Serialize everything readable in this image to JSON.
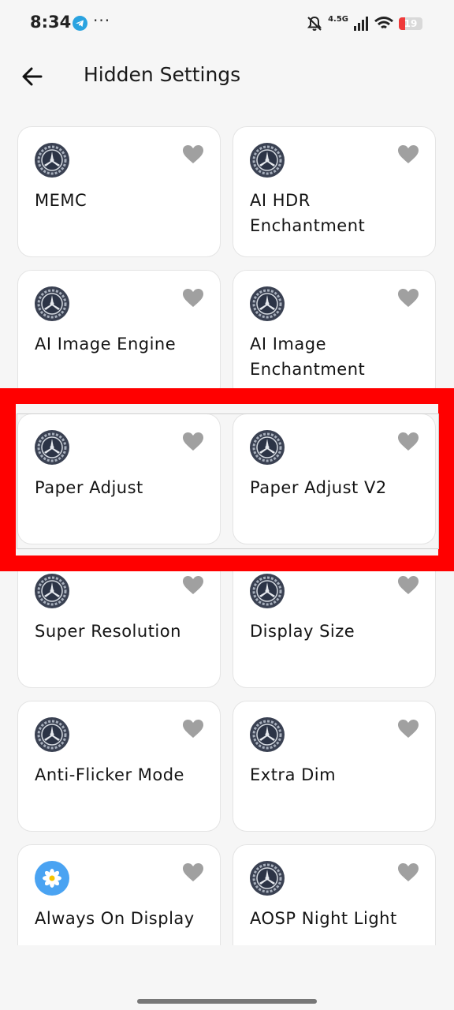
{
  "status_bar": {
    "time": "8:34",
    "more": "···",
    "network": "4.5G",
    "battery_level": "19"
  },
  "header": {
    "title": "Hidden Settings",
    "back_icon": "arrow-left-icon"
  },
  "cards": [
    {
      "label": "MEMC",
      "icon": "gear-icon",
      "favorite": false
    },
    {
      "label": "AI HDR Enchantment",
      "icon": "gear-icon",
      "favorite": false
    },
    {
      "label": "AI Image Engine",
      "icon": "gear-icon",
      "favorite": false
    },
    {
      "label": "AI Image Enchantment",
      "icon": "gear-icon",
      "favorite": false
    },
    {
      "label": "Paper Adjust",
      "icon": "gear-icon",
      "favorite": false
    },
    {
      "label": "Paper Adjust V2",
      "icon": "gear-icon",
      "favorite": false
    },
    {
      "label": "Super Resolution",
      "icon": "gear-icon",
      "favorite": false
    },
    {
      "label": "Display Size",
      "icon": "gear-icon",
      "favorite": false
    },
    {
      "label": "Anti-Flicker Mode",
      "icon": "gear-icon",
      "favorite": false
    },
    {
      "label": "Extra Dim",
      "icon": "gear-icon",
      "favorite": false
    },
    {
      "label": "Always On Display",
      "icon": "aod-flower-icon",
      "favorite": false
    },
    {
      "label": "AOSP Night Light",
      "icon": "gear-icon",
      "favorite": false
    }
  ],
  "colors": {
    "highlight": "#ff0000",
    "heart": "#a0a0a0",
    "battery_low": "#ef3b3b"
  }
}
